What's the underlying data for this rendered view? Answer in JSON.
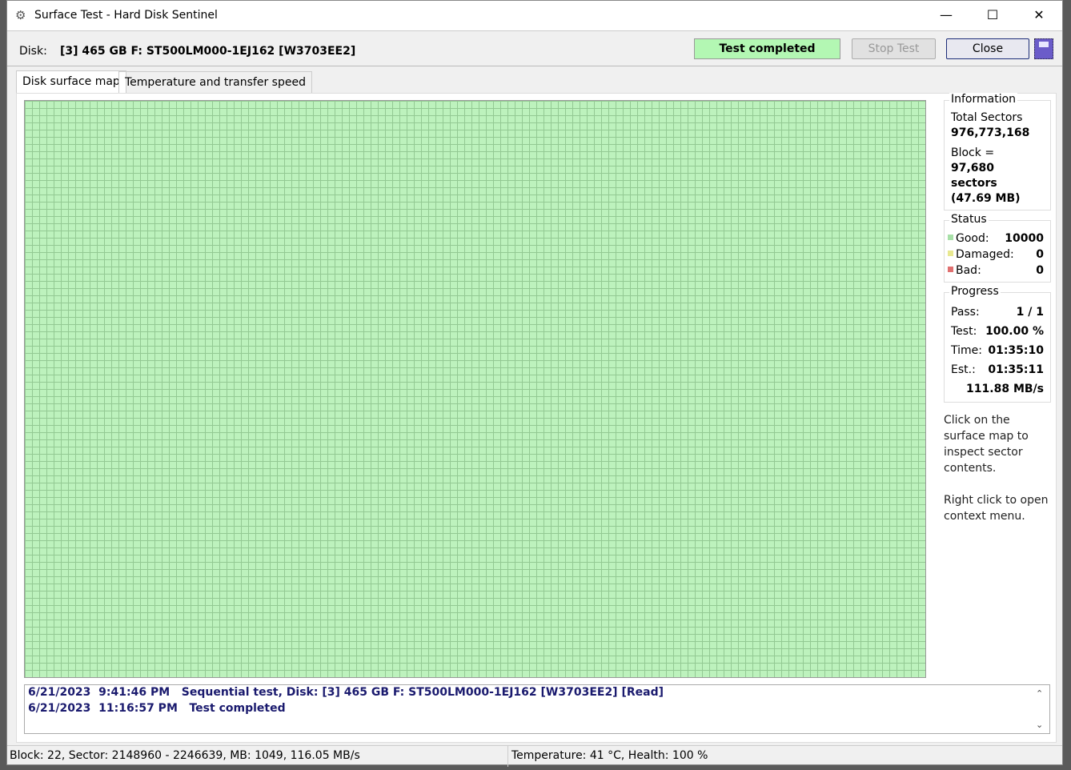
{
  "window": {
    "title": "Surface Test - Hard Disk Sentinel",
    "icon": "hdsentinel-app-icon",
    "controls": {
      "minimize": "—",
      "maximize": "☐",
      "close": "✕"
    }
  },
  "toolbar": {
    "disk_label": "Disk:",
    "disk_value": "[3] 465 GB F: ST500LM000-1EJ162 [W3703EE2]",
    "status": "Test completed",
    "status_color": "#b3f7b3",
    "stop_label": "Stop Test",
    "close_label": "Close",
    "save_icon": "floppy-disk-icon"
  },
  "tabs": [
    {
      "label": "Disk surface map",
      "active": true
    },
    {
      "label": "Temperature and transfer speed",
      "active": false
    }
  ],
  "surface_map": {
    "blocks": 10000,
    "good_color": "#bdf2bd",
    "state": "all good"
  },
  "information": {
    "title": "Information",
    "total_sectors_label": "Total Sectors",
    "total_sectors": "976,773,168",
    "block_label": "Block =",
    "block_sectors": "97,680 sectors",
    "block_mb": "(47.69 MB)"
  },
  "status": {
    "title": "Status",
    "items": [
      {
        "label": "Good:",
        "value": "10000",
        "color": "#a8e0a8"
      },
      {
        "label": "Damaged:",
        "value": "0",
        "color": "#e8e890"
      },
      {
        "label": "Bad:",
        "value": "0",
        "color": "#e07070"
      }
    ]
  },
  "progress": {
    "title": "Progress",
    "items": [
      {
        "label": "Pass:",
        "value": "1 / 1"
      },
      {
        "label": "Test:",
        "value": "100.00 %"
      },
      {
        "label": "Time:",
        "value": "01:35:10"
      },
      {
        "label": "Est.:",
        "value": "01:35:11"
      }
    ],
    "speed": "111.88 MB/s"
  },
  "hints": [
    "Click on the surface map to inspect sector contents.",
    "Right click to open context menu."
  ],
  "log": [
    "6/21/2023  9:41:46 PM   Sequential test, Disk: [3] 465 GB F: ST500LM000-1EJ162 [W3703EE2] [Read]",
    "6/21/2023  11:16:57 PM   Test completed"
  ],
  "statusbar": {
    "block_info": "Block: 22, Sector: 2148960 - 2246639, MB: 1049, 116.05 MB/s",
    "health_info": "Temperature: 41  °C,  Health: 100 %"
  }
}
